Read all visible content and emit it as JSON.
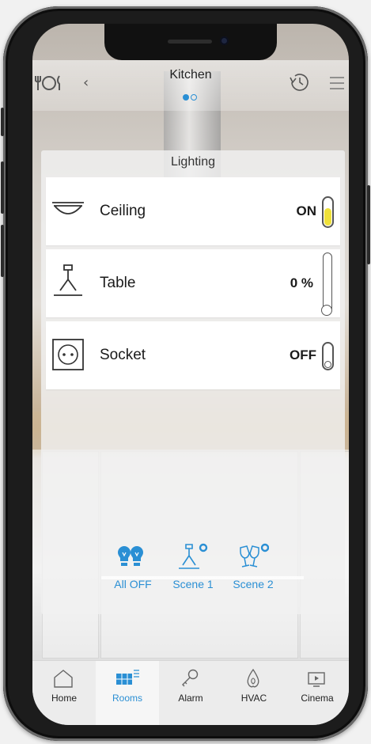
{
  "header": {
    "room_title": "Kitchen",
    "back_glyph": "‹",
    "room_icon": "dining-icon",
    "history_icon": "history-icon",
    "menu_icon": "menu-icon",
    "pages": {
      "active": 1,
      "total": 2
    }
  },
  "lighting": {
    "section_label": "Lighting",
    "rows": [
      {
        "label": "Ceiling",
        "state": "ON",
        "icon": "ceiling-light-icon",
        "control": "toggle",
        "on": true
      },
      {
        "label": "Table",
        "state": "0 %",
        "icon": "table-lamp-icon",
        "control": "dimmer",
        "level_percent": 0
      },
      {
        "label": "Socket",
        "state": "OFF",
        "icon": "socket-icon",
        "control": "toggle",
        "on": false
      }
    ]
  },
  "scenes": [
    {
      "label": "All OFF",
      "icon": "bulbs-off-icon"
    },
    {
      "label": "Scene 1",
      "icon": "lamp-settings-icon"
    },
    {
      "label": "Scene 2",
      "icon": "cheers-settings-icon"
    }
  ],
  "tabbar": {
    "active": "Rooms",
    "tabs": [
      {
        "label": "Home",
        "icon": "home-icon"
      },
      {
        "label": "Rooms",
        "icon": "rooms-icon"
      },
      {
        "label": "Alarm",
        "icon": "key-icon"
      },
      {
        "label": "HVAC",
        "icon": "flame-icon"
      },
      {
        "label": "Cinema",
        "icon": "tv-icon"
      }
    ]
  },
  "colors": {
    "accent": "#2a8fd4",
    "toggle_on": "#efe13a",
    "text": "#1a1a1a"
  }
}
